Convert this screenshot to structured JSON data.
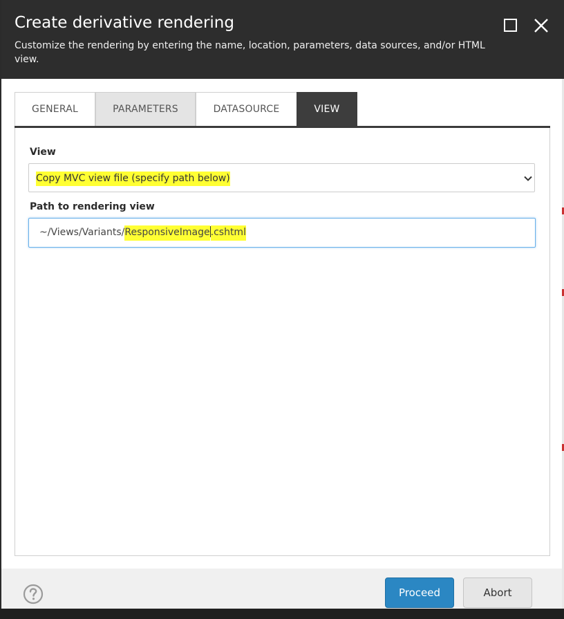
{
  "dialog": {
    "title": "Create derivative rendering",
    "subtitle": "Customize the rendering by entering the name, location, parameters, data sources, and/or HTML view.",
    "controls": {
      "maximize_icon": "maximize-icon",
      "close_icon": "close-icon"
    }
  },
  "tabs": [
    {
      "label": "GENERAL",
      "active": false
    },
    {
      "label": "PARAMETERS",
      "active": false
    },
    {
      "label": "DATASOURCE",
      "active": false
    },
    {
      "label": "VIEW",
      "active": true
    }
  ],
  "view_field": {
    "label": "View",
    "selected": "Copy MVC view file (specify path below)",
    "icon": "chevron-down-icon"
  },
  "path_field": {
    "label": "Path to rendering view",
    "value_prefix": "~/Views/Variants/",
    "value_highlight_a": "ResponsiveImage",
    "value_highlight_b": ".cshtml"
  },
  "footer": {
    "help_icon": "help-icon",
    "proceed_label": "Proceed",
    "abort_label": "Abort"
  },
  "colors": {
    "header_bg": "#2d2d2d",
    "active_tab": "#3d3d3d",
    "highlight": "#ffff33",
    "primary_button": "#2b87c3"
  }
}
